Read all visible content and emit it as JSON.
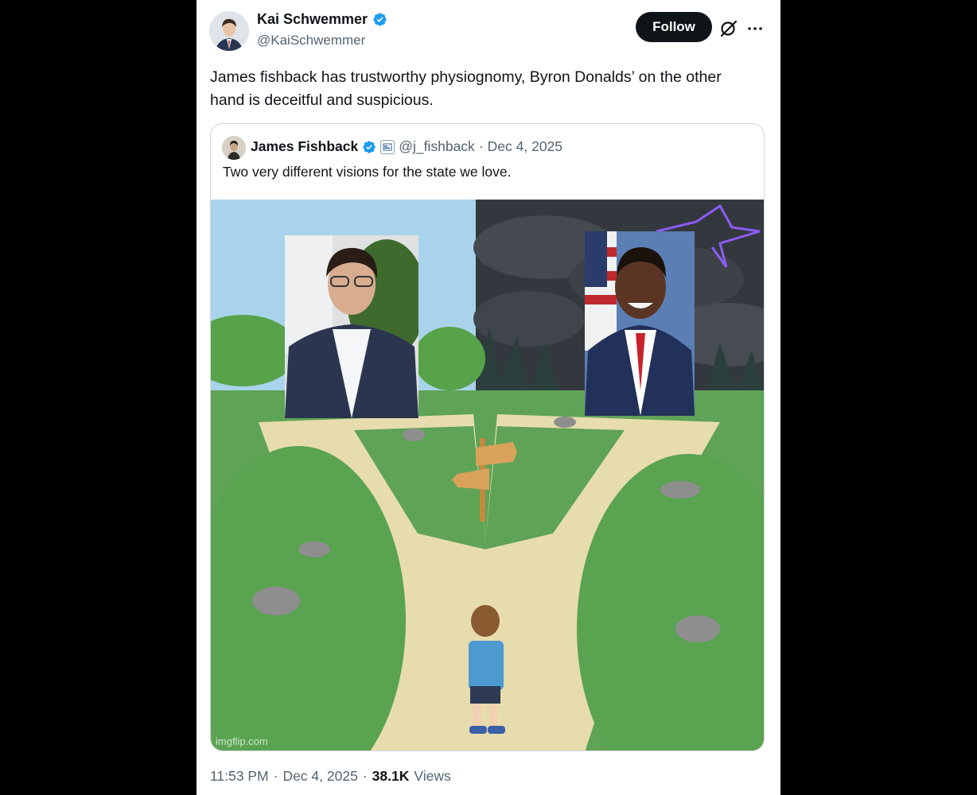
{
  "tweet": {
    "display_name": "Kai Schwemmer",
    "handle": "@KaiSchwemmer",
    "follow_label": "Follow",
    "text": "James fishback has trustworthy physiognomy, Byron Donalds’ on the other hand is deceitful and suspicious.",
    "time": "11:53 PM",
    "separator": "·",
    "date": "Dec 4, 2025",
    "views_count": "38.1K",
    "views_label": "Views"
  },
  "quote": {
    "display_name": "James Fishback",
    "handle": "@j_fishback",
    "separator": "·",
    "date": "Dec 4, 2025",
    "text": "Two very different visions for the state we love.",
    "watermark": "imgflip.com"
  },
  "colors": {
    "verified": "#1d9bf0",
    "follow_bg": "#0f1419",
    "secondary_text": "#536471"
  },
  "icons": [
    "verified-badge-icon",
    "grok-icon",
    "more-icon",
    "affiliate-badge-icon"
  ]
}
